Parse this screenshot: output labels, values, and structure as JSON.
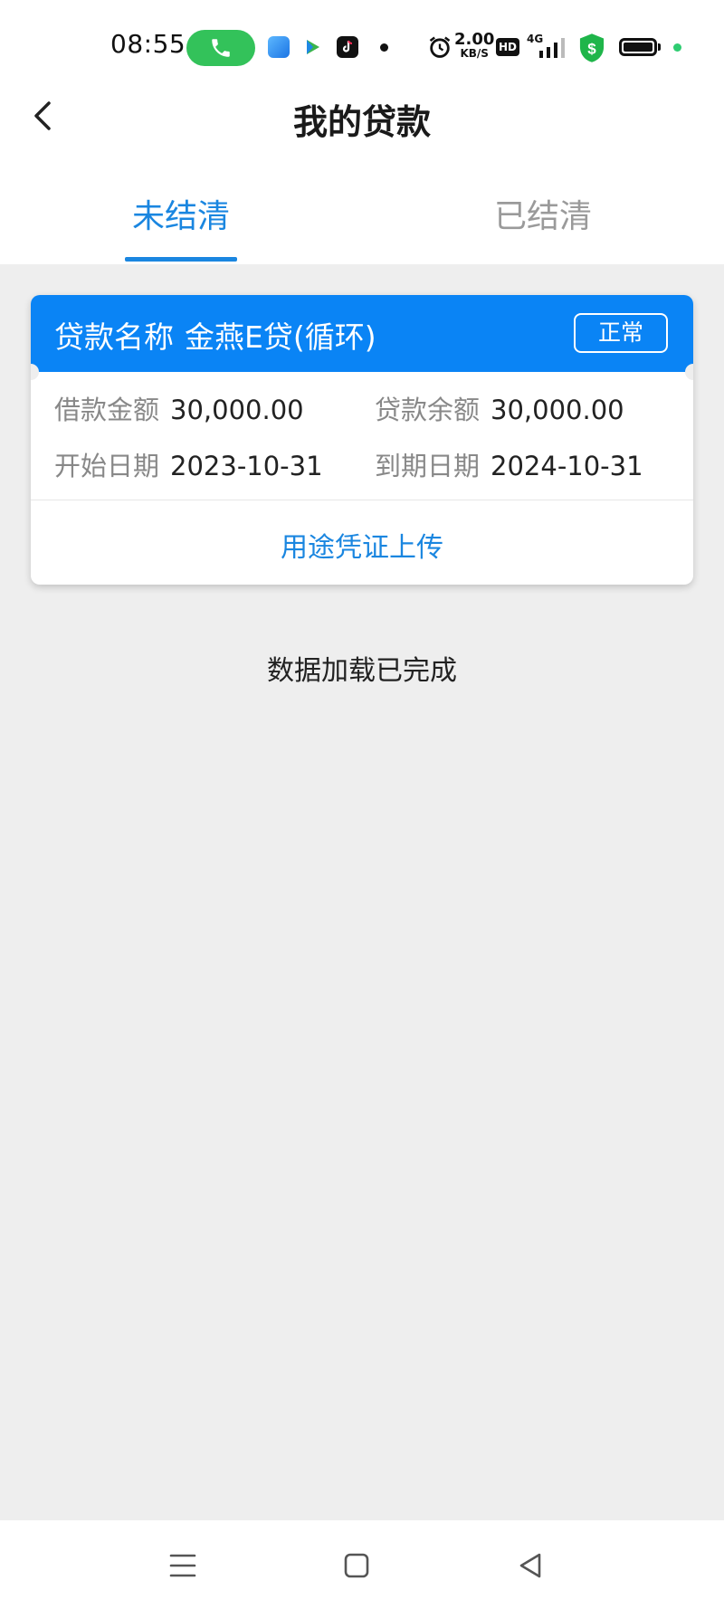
{
  "status_bar": {
    "time": "08:55",
    "speed_value": "2.00",
    "speed_unit": "KB/S",
    "hd_badge": "HD",
    "network_type": "4G",
    "call_pill_color": "#33c25a",
    "icons": [
      "phone-icon",
      "app-icon-blue",
      "app-icon-video",
      "tiktok-icon",
      "alarm-icon",
      "signal-icon",
      "security-shield-icon",
      "battery-icon"
    ]
  },
  "header": {
    "title": "我的贷款"
  },
  "tabs": [
    {
      "label": "未结清",
      "active": true
    },
    {
      "label": "已结清",
      "active": false
    }
  ],
  "loan_card": {
    "name_label": "贷款名称",
    "name_value": "金燕E贷(循环)",
    "status": "正常",
    "fields": [
      {
        "label": "借款金额",
        "value": "30,000.00"
      },
      {
        "label": "贷款余额",
        "value": "30,000.00"
      },
      {
        "label": "开始日期",
        "value": "2023-10-31"
      },
      {
        "label": "到期日期",
        "value": "2024-10-31"
      }
    ],
    "action": "用途凭证上传"
  },
  "load_status": "数据加载已完成",
  "colors": {
    "accent": "#1a86e0",
    "card_header": "#0a84f5",
    "background": "#eeeeee"
  },
  "nav_bar": {
    "icons": [
      "menu-icon",
      "home-square-icon",
      "back-triangle-icon"
    ]
  }
}
